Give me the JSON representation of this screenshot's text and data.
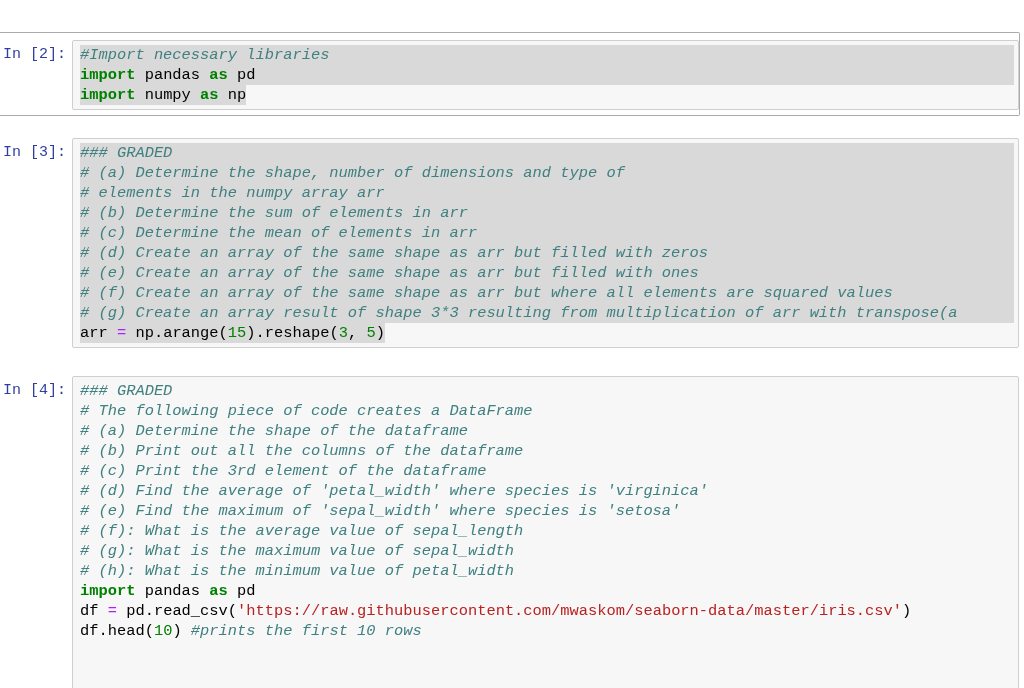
{
  "cells": [
    {
      "prompt": "In [2]:",
      "selected": true,
      "lines": [
        {
          "selected": true,
          "tokens": [
            {
              "kind": "comment",
              "text": "#Import necessary libraries"
            }
          ]
        },
        {
          "selected": true,
          "tokens": [
            {
              "kind": "keyword",
              "text": "import"
            },
            {
              "kind": "plain",
              "text": " pandas "
            },
            {
              "kind": "keyword",
              "text": "as"
            },
            {
              "kind": "plain",
              "text": " pd"
            }
          ]
        },
        {
          "selected": true,
          "tokens": [
            {
              "kind": "keyword",
              "text": "import"
            },
            {
              "kind": "plain",
              "text": " numpy "
            },
            {
              "kind": "keyword",
              "text": "as"
            },
            {
              "kind": "plain",
              "text": " np"
            }
          ]
        }
      ]
    },
    {
      "prompt": "In [3]:",
      "selected": false,
      "lines": [
        {
          "selected": true,
          "tokens": [
            {
              "kind": "comment",
              "text": "### GRADED"
            }
          ]
        },
        {
          "selected": true,
          "tokens": [
            {
              "kind": "comment",
              "text": "# (a) Determine the shape, number of dimensions and type of"
            }
          ]
        },
        {
          "selected": true,
          "tokens": [
            {
              "kind": "comment",
              "text": "# elements in the numpy array arr"
            }
          ]
        },
        {
          "selected": true,
          "tokens": [
            {
              "kind": "comment",
              "text": "# (b) Determine the sum of elements in arr"
            }
          ]
        },
        {
          "selected": true,
          "tokens": [
            {
              "kind": "comment",
              "text": "# (c) Determine the mean of elements in arr"
            }
          ]
        },
        {
          "selected": true,
          "tokens": [
            {
              "kind": "comment",
              "text": "# (d) Create an array of the same shape as arr but filled with zeros"
            }
          ]
        },
        {
          "selected": true,
          "tokens": [
            {
              "kind": "comment",
              "text": "# (e) Create an array of the same shape as arr but filled with ones"
            }
          ]
        },
        {
          "selected": true,
          "tokens": [
            {
              "kind": "comment",
              "text": "# (f) Create an array of the same shape as arr but where all elements are squared values"
            }
          ]
        },
        {
          "selected": true,
          "tokens": [
            {
              "kind": "comment",
              "text": "# (g) Create an array result of shape 3*3 resulting from multiplication of arr with transpose(a"
            }
          ]
        },
        {
          "selected": true,
          "tokens": [
            {
              "kind": "plain",
              "text": "arr "
            },
            {
              "kind": "operator",
              "text": "="
            },
            {
              "kind": "plain",
              "text": " np.arange("
            },
            {
              "kind": "number",
              "text": "15"
            },
            {
              "kind": "plain",
              "text": ").reshape("
            },
            {
              "kind": "number",
              "text": "3"
            },
            {
              "kind": "plain",
              "text": ", "
            },
            {
              "kind": "number",
              "text": "5"
            },
            {
              "kind": "plain",
              "text": ")"
            }
          ]
        }
      ]
    },
    {
      "prompt": "In [4]:",
      "selected": false,
      "lines": [
        {
          "selected": false,
          "tokens": [
            {
              "kind": "comment",
              "text": "### GRADED"
            }
          ]
        },
        {
          "selected": false,
          "tokens": [
            {
              "kind": "comment",
              "text": "# The following piece of code creates a DataFrame"
            }
          ]
        },
        {
          "selected": false,
          "tokens": [
            {
              "kind": "comment",
              "text": "# (a) Determine the shape of the dataframe"
            }
          ]
        },
        {
          "selected": false,
          "tokens": [
            {
              "kind": "comment",
              "text": "# (b) Print out all the columns of the dataframe"
            }
          ]
        },
        {
          "selected": false,
          "tokens": [
            {
              "kind": "comment",
              "text": "# (c) Print the 3rd element of the dataframe"
            }
          ]
        },
        {
          "selected": false,
          "tokens": [
            {
              "kind": "comment",
              "text": "# (d) Find the average of 'petal_width' where species is 'virginica'"
            }
          ]
        },
        {
          "selected": false,
          "tokens": [
            {
              "kind": "comment",
              "text": "# (e) Find the maximum of 'sepal_width' where species is 'setosa'"
            }
          ]
        },
        {
          "selected": false,
          "tokens": [
            {
              "kind": "comment",
              "text": "# (f): What is the average value of sepal_length"
            }
          ]
        },
        {
          "selected": false,
          "tokens": [
            {
              "kind": "comment",
              "text": "# (g): What is the maximum value of sepal_width"
            }
          ]
        },
        {
          "selected": false,
          "tokens": [
            {
              "kind": "comment",
              "text": "# (h): What is the minimum value of petal_width"
            }
          ]
        },
        {
          "selected": false,
          "tokens": [
            {
              "kind": "keyword",
              "text": "import"
            },
            {
              "kind": "plain",
              "text": " pandas "
            },
            {
              "kind": "keyword",
              "text": "as"
            },
            {
              "kind": "plain",
              "text": " pd"
            }
          ]
        },
        {
          "selected": false,
          "tokens": [
            {
              "kind": "plain",
              "text": "df "
            },
            {
              "kind": "operator",
              "text": "="
            },
            {
              "kind": "plain",
              "text": " pd.read_csv("
            },
            {
              "kind": "string",
              "text": "'https://raw.githubusercontent.com/mwaskom/seaborn-data/master/iris.csv'"
            },
            {
              "kind": "plain",
              "text": ")"
            }
          ]
        },
        {
          "selected": false,
          "tokens": [
            {
              "kind": "plain",
              "text": "df.head("
            },
            {
              "kind": "number",
              "text": "10"
            },
            {
              "kind": "plain",
              "text": ") "
            },
            {
              "kind": "comment",
              "text": "#prints the first 10 rows"
            }
          ]
        }
      ]
    }
  ]
}
